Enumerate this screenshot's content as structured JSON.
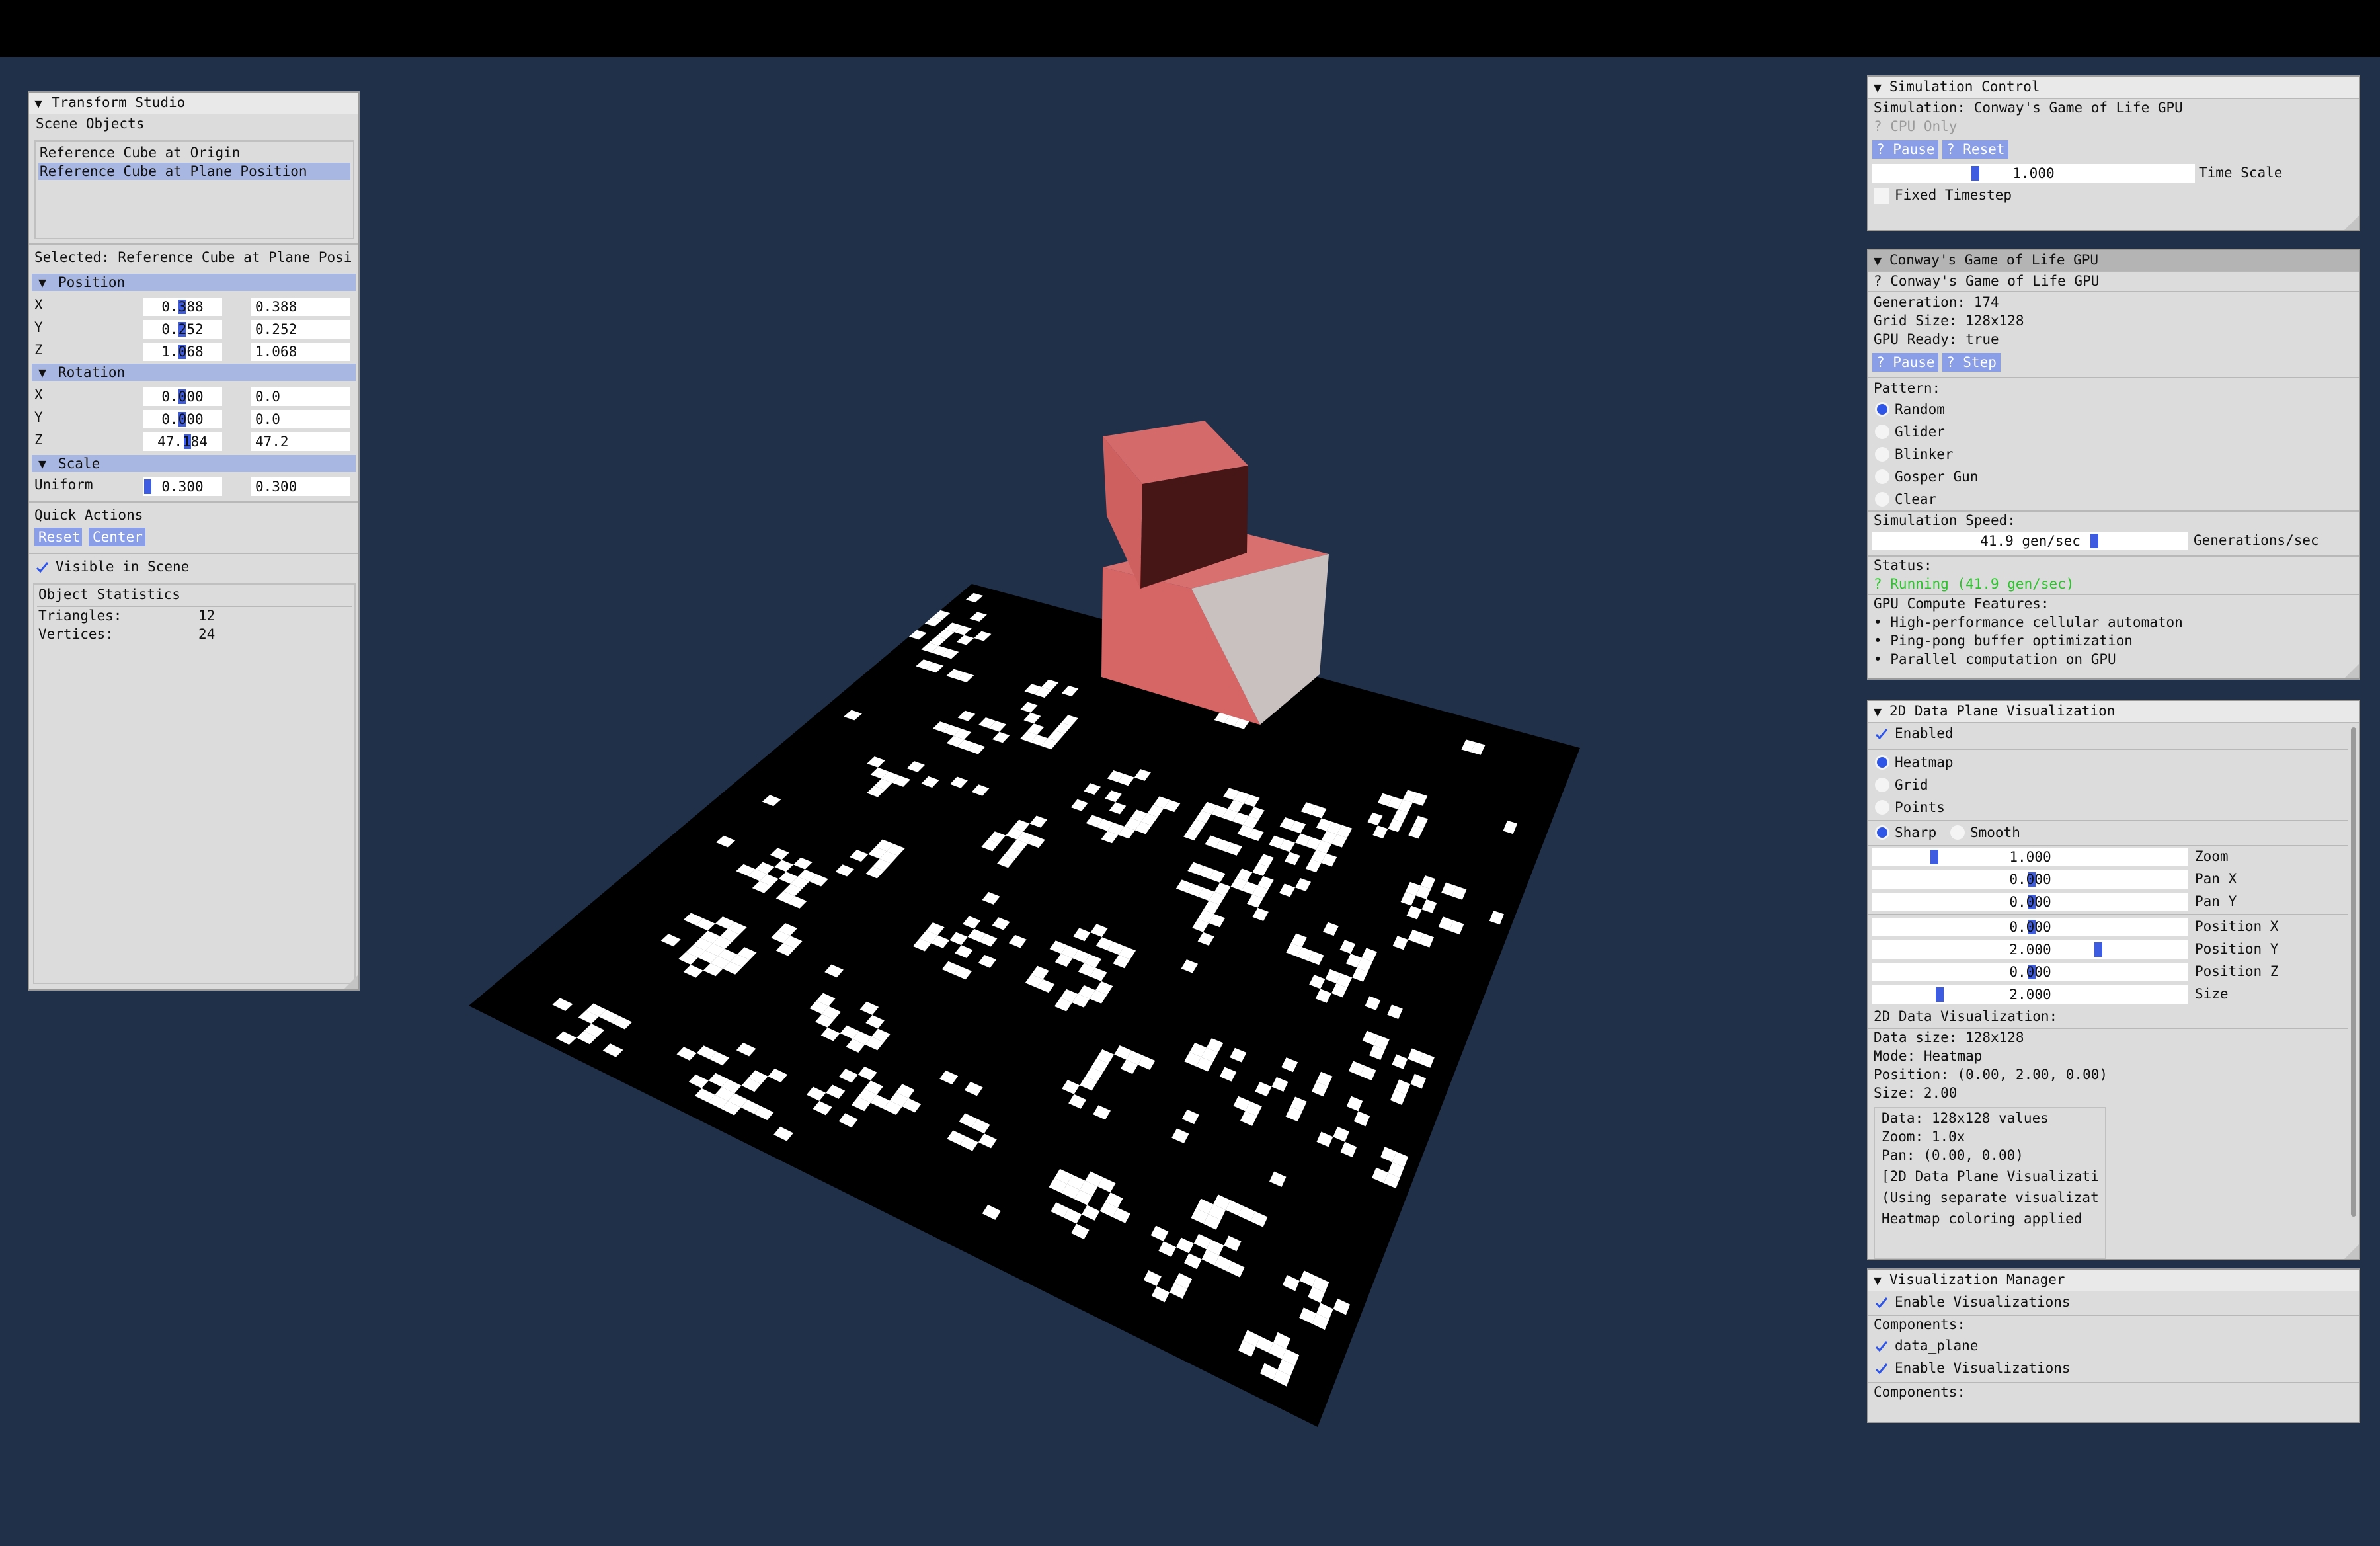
{
  "transform_studio": {
    "title": "Transform Studio",
    "scene_objects_label": "Scene Objects",
    "objects": [
      "Reference Cube at Origin",
      "Reference Cube at Plane Position"
    ],
    "selected": "Selected: Reference Cube at Plane Posi",
    "position": {
      "label": "Position",
      "rows": [
        {
          "axis": "X",
          "input": "0.388",
          "value": "0.388"
        },
        {
          "axis": "Y",
          "input": "0.252",
          "value": "0.252"
        },
        {
          "axis": "Z",
          "input": "1.068",
          "value": "1.068"
        }
      ]
    },
    "rotation": {
      "label": "Rotation",
      "rows": [
        {
          "axis": "X",
          "input": "0.000",
          "value": "0.0"
        },
        {
          "axis": "Y",
          "input": "0.000",
          "value": "0.0"
        },
        {
          "axis": "Z",
          "input": "47.184",
          "value": "47.2"
        }
      ]
    },
    "scale": {
      "label": "Scale",
      "row_label": "Uniform",
      "input": "0.300",
      "value": "0.300"
    },
    "quick_actions": {
      "label": "Quick Actions",
      "reset": "Reset",
      "center": "Center"
    },
    "visible_in_scene": "Visible in Scene",
    "stats": {
      "label": "Object Statistics",
      "triangles_label": "Triangles:",
      "triangles": "12",
      "vertices_label": "Vertices:",
      "vertices": "24"
    }
  },
  "simulation_control": {
    "title": "Simulation Control",
    "simulation": "Simulation: Conway's Game of Life GPU",
    "cpu_only": "? CPU Only",
    "pause": "? Pause",
    "reset": "? Reset",
    "time_scale_value": "1.000",
    "time_scale_label": "Time Scale",
    "fixed_timestep": "Fixed Timestep"
  },
  "game_of_life": {
    "title": "Conway's Game of Life GPU",
    "subtitle": "? Conway's Game of Life GPU",
    "generation": "Generation: 174",
    "grid_size": "Grid Size: 128x128",
    "gpu_ready": "GPU Ready: true",
    "pause": "? Pause",
    "step": "? Step",
    "pattern_label": "Pattern:",
    "patterns": [
      "Random",
      "Glider",
      "Blinker",
      "Gosper Gun",
      "Clear"
    ],
    "selected_pattern": "Random",
    "speed_label": "Simulation Speed:",
    "speed_value": "41.9 gen/sec",
    "speed_unit": "Generations/sec",
    "status_label": "Status:",
    "status_value": "? Running (41.9 gen/sec)",
    "features_label": "GPU Compute Features:",
    "features": [
      "• High-performance cellular automaton",
      "• Ping-pong buffer optimization",
      "• Parallel computation on GPU"
    ]
  },
  "data_plane": {
    "title": "2D Data Plane Visualization",
    "enabled": "Enabled",
    "modes": [
      "Heatmap",
      "Grid",
      "Points"
    ],
    "selected_mode": "Heatmap",
    "sharp": "Sharp",
    "smooth": "Smooth",
    "sliders": [
      {
        "value": "1.000",
        "label": "Zoom"
      },
      {
        "value": "0.000",
        "label": "Pan X"
      },
      {
        "value": "0.000",
        "label": "Pan Y"
      },
      {
        "value": "0.000",
        "label": "Position X"
      },
      {
        "value": "2.000",
        "label": "Position Y"
      },
      {
        "value": "0.000",
        "label": "Position Z"
      },
      {
        "value": "2.000",
        "label": "Size"
      }
    ],
    "info_title": "2D Data Visualization:",
    "info": [
      "Data size: 128x128",
      "Mode: Heatmap",
      "Position: (0.00, 2.00, 0.00)",
      "Size: 2.00"
    ],
    "log": [
      "Data: 128x128 values",
      "Zoom: 1.0x",
      "Pan: (0.00, 0.00)",
      "[2D Data Plane Visualizati",
      "(Using separate visualizat",
      "Heatmap coloring applied"
    ]
  },
  "viz_manager": {
    "title": "Visualization Manager",
    "enable": "Enable Visualizations",
    "components_label": "Components:",
    "items": [
      "data_plane",
      "Enable Visualizations"
    ],
    "components_label_2": "Components:"
  },
  "colors": {
    "background": "#213049",
    "cube": "#d86a6a",
    "plane": "#000000",
    "cells": "#ffffff",
    "accent": "#3e5ce0"
  }
}
